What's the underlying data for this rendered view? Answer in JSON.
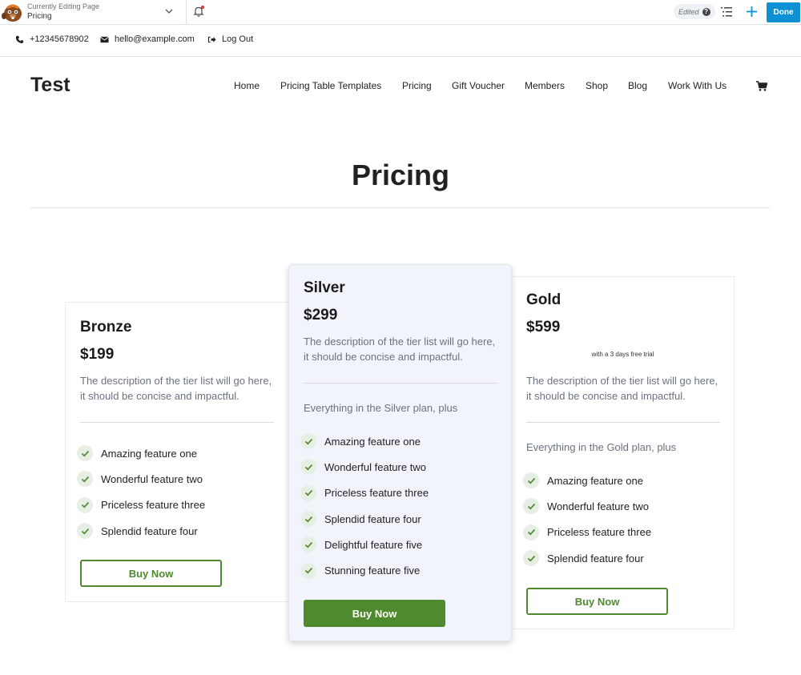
{
  "builder_bar": {
    "editing_label": "Currently Editing Page",
    "editing_page": "Pricing",
    "status": "Edited",
    "done_label": "Done",
    "colors": {
      "accent": "#0e91d4",
      "notification_dot": "#d63638"
    }
  },
  "contact_bar": {
    "phone": "+12345678902",
    "email": "hello@example.com",
    "logout": "Log Out"
  },
  "header": {
    "site_title": "Test",
    "nav": [
      {
        "label": "Home"
      },
      {
        "label": "Pricing Table Templates"
      },
      {
        "label": "Pricing"
      },
      {
        "label": "Gift Voucher"
      },
      {
        "label": "Members"
      },
      {
        "label": "Shop"
      },
      {
        "label": "Blog"
      },
      {
        "label": "Work With Us"
      }
    ],
    "cart_icon": "cart-icon"
  },
  "page": {
    "title": "Pricing"
  },
  "pricing": {
    "accent": "#4f8a2f",
    "plans": [
      {
        "name": "Bronze",
        "price": "$199",
        "description": "The description of the tier list will go here, it should be concise and impactful.",
        "features": [
          "Amazing feature one",
          "Wonderful feature two",
          "Priceless feature three",
          "Splendid feature four"
        ],
        "button": "Buy Now"
      },
      {
        "name": "Silver",
        "price": "$299",
        "description": "The description of the tier list will go here, it should be concise and impactful.",
        "includes": "Everything in the Silver plan, plus",
        "features": [
          "Amazing feature one",
          "Wonderful feature two",
          "Priceless feature three",
          "Splendid feature four",
          "Delightful feature five",
          "Stunning feature five"
        ],
        "button": "Buy Now",
        "featured": true
      },
      {
        "name": "Gold",
        "price": "$599",
        "trial": "with a 3 days free trial",
        "description": "The description of the tier list will go here, it should be concise and impactful.",
        "includes": "Everything in the Gold plan, plus",
        "features": [
          "Amazing feature one",
          "Wonderful feature two",
          "Priceless feature three",
          "Splendid feature four"
        ],
        "button": "Buy Now"
      }
    ]
  }
}
